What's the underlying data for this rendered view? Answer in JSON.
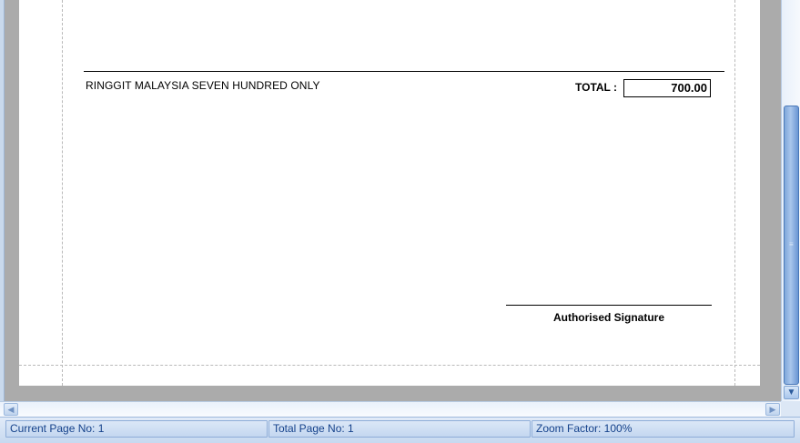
{
  "report": {
    "amount_in_words": "RINGGIT MALAYSIA SEVEN HUNDRED ONLY",
    "total_label": "TOTAL :",
    "total_value": "700.00",
    "signature_label": "Authorised Signature"
  },
  "scrollbars": {
    "vertical_down_icon": "▼",
    "vertical_grip": "≡",
    "horizontal_left_icon": "◀",
    "horizontal_right_icon": "▶"
  },
  "statusbar": {
    "current_page": "Current Page No: 1",
    "total_page": "Total Page No: 1",
    "zoom_factor": "Zoom Factor: 100%"
  },
  "colors": {
    "viewer_background": "#ababab",
    "status_text": "#15428b",
    "scroll_thumb": "#7fa7da"
  }
}
